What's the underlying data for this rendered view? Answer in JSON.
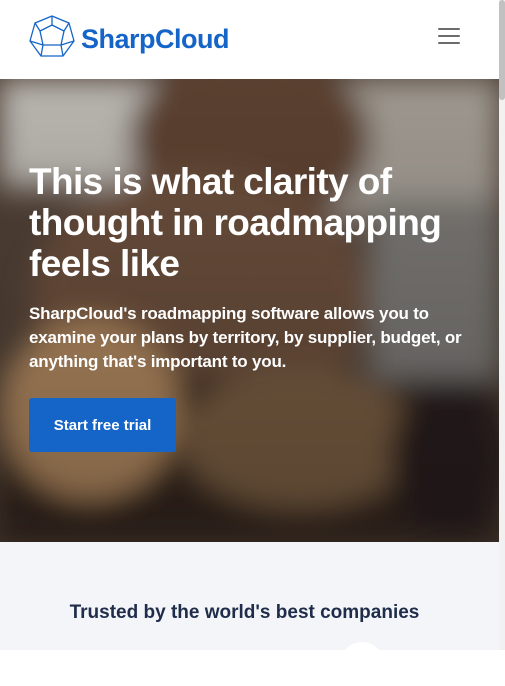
{
  "header": {
    "logo_text": "SharpCloud",
    "logo_icon": "dodecahedron-logo-icon",
    "menu_icon": "hamburger-menu-icon"
  },
  "hero": {
    "title": "This is what clarity of thought in roadmapping feels like",
    "subtitle": "SharpCloud's roadmapping software allows you to examine your plans by territory, by supplier, budget, or anything that's important to you.",
    "cta_label": "Start free trial"
  },
  "trusted": {
    "title": "Trusted by the world's best companies"
  },
  "colors": {
    "brand": "#1565c8",
    "hero_text": "#ffffff",
    "section_bg": "#f3f5f8",
    "heading_dark": "#1f2d4a"
  }
}
